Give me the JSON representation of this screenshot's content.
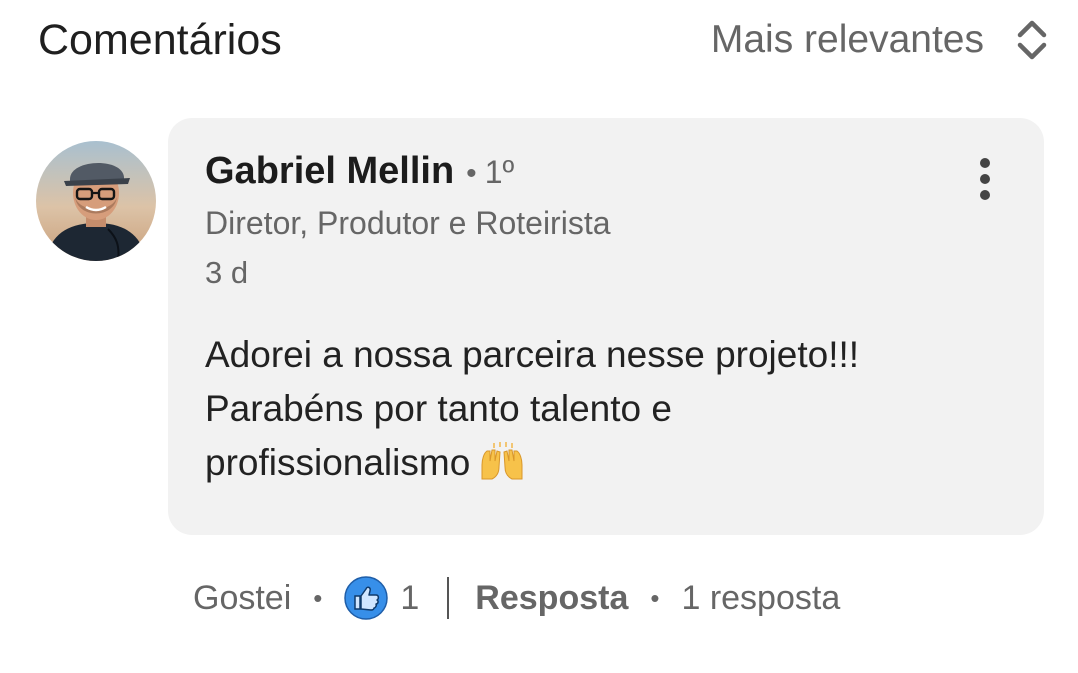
{
  "header": {
    "title": "Comentários",
    "sort_label": "Mais relevantes",
    "sort_icon": "sort-updown-icon"
  },
  "comment": {
    "author": {
      "name": "Gabriel Mellin",
      "separator": "•",
      "degree": "1º",
      "headline": "Diretor, Produtor e Roteirista",
      "avatar_icon": "avatar-photo"
    },
    "time": "3 d",
    "text_lines": [
      "Adorei a nossa parceira nesse projeto!!!",
      "Parabéns por tanto talento e",
      "profissionalismo"
    ],
    "emoji_icon": "raising-hands-emoji",
    "more_icon": "more-vertical-icon"
  },
  "actions": {
    "like_label": "Gostei",
    "separator": "•",
    "reaction_icon": "like-thumbs-up-icon",
    "reaction_count": "1",
    "reply_label": "Resposta",
    "replies_text": "1 resposta"
  },
  "colors": {
    "bubble_bg": "#f2f2f2",
    "secondary_text": "#666666",
    "like_blue": "#378fe9"
  }
}
